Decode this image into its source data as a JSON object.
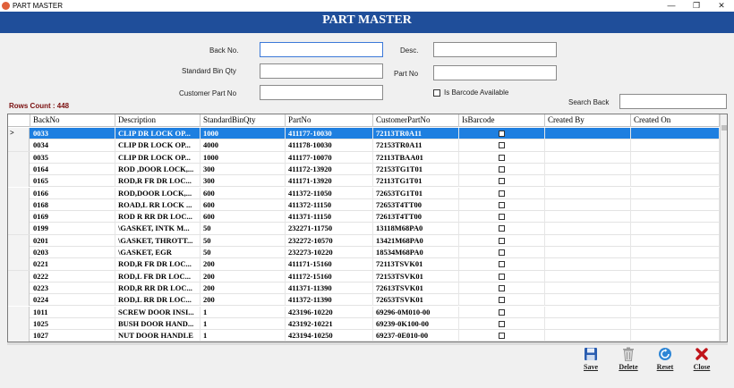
{
  "window": {
    "title": "PART MASTER",
    "minimize_glyph": "—",
    "restore_glyph": "❐",
    "close_glyph": "✕"
  },
  "header": {
    "title": "PART MASTER"
  },
  "form": {
    "back_no": {
      "label": "Back No.",
      "value": ""
    },
    "standard_bin_qty": {
      "label": "Standard Bin Qty",
      "value": ""
    },
    "customer_part_no": {
      "label": "Customer Part No",
      "value": ""
    },
    "desc": {
      "label": "Desc.",
      "value": ""
    },
    "part_no": {
      "label": "Part No",
      "value": ""
    },
    "is_barcode_available": {
      "label": "Is Barcode Available",
      "checked": false
    },
    "search_back": {
      "label": "Search Back",
      "value": ""
    }
  },
  "rows_count": "Rows Count : 448",
  "grid": {
    "columns": [
      "BackNo",
      "Description",
      "StandardBinQty",
      "PartNo",
      "CustomerPartNo",
      "IsBarcode",
      "Created By",
      "Created On"
    ],
    "selected_row_marker": ">",
    "rows": [
      {
        "back_no": "0033",
        "description": "CLIP DR LOCK OP...",
        "bin_qty": "1000",
        "part_no": "411177-10030",
        "customer_part_no": "72113TR0A11",
        "is_barcode": false,
        "created_by": "",
        "created_on": ""
      },
      {
        "back_no": "0034",
        "description": "CLIP DR LOCK OP...",
        "bin_qty": "4000",
        "part_no": "411178-10030",
        "customer_part_no": "72153TR0A11",
        "is_barcode": false,
        "created_by": "",
        "created_on": ""
      },
      {
        "back_no": "0035",
        "description": "CLIP DR LOCK OP...",
        "bin_qty": "1000",
        "part_no": "411177-10070",
        "customer_part_no": "72113TBAA01",
        "is_barcode": false,
        "created_by": "",
        "created_on": ""
      },
      {
        "back_no": "0164",
        "description": "ROD ,DOOR LOCK,...",
        "bin_qty": "300",
        "part_no": "411172-13920",
        "customer_part_no": "72153TG1T01",
        "is_barcode": false,
        "created_by": "",
        "created_on": ""
      },
      {
        "back_no": "0165",
        "description": "ROD,R FR DR LOC...",
        "bin_qty": "300",
        "part_no": "411171-13920",
        "customer_part_no": "72113TG1T01",
        "is_barcode": false,
        "created_by": "",
        "created_on": ""
      },
      {
        "back_no": "0166",
        "description": "ROD,DOOR LOCK,...",
        "bin_qty": "600",
        "part_no": "411372-11050",
        "customer_part_no": "72653TG1T01",
        "is_barcode": false,
        "created_by": "",
        "created_on": ""
      },
      {
        "back_no": "0168",
        "description": "ROAD,L RR LOCK ...",
        "bin_qty": "600",
        "part_no": "411372-11150",
        "customer_part_no": "72653T4TT00",
        "is_barcode": false,
        "created_by": "",
        "created_on": ""
      },
      {
        "back_no": "0169",
        "description": "ROD R RR DR LOC...",
        "bin_qty": "600",
        "part_no": "411371-11150",
        "customer_part_no": "72613T4TT00",
        "is_barcode": false,
        "created_by": "",
        "created_on": ""
      },
      {
        "back_no": "0199",
        "description": "\\GASKET, INTK M...",
        "bin_qty": "50",
        "part_no": "232271-11750",
        "customer_part_no": "13118M68PA0",
        "is_barcode": false,
        "created_by": "",
        "created_on": ""
      },
      {
        "back_no": "0201",
        "description": "\\GASKET, THROTT...",
        "bin_qty": "50",
        "part_no": "232272-10570",
        "customer_part_no": "13421M68PA0",
        "is_barcode": false,
        "created_by": "",
        "created_on": ""
      },
      {
        "back_no": "0203",
        "description": "\\GASKET, EGR",
        "bin_qty": "50",
        "part_no": "232273-10220",
        "customer_part_no": "18534M68PA0",
        "is_barcode": false,
        "created_by": "",
        "created_on": ""
      },
      {
        "back_no": "0221",
        "description": "ROD,R FR DR LOC...",
        "bin_qty": "200",
        "part_no": "411171-15160",
        "customer_part_no": "72113TSVK01",
        "is_barcode": false,
        "created_by": "",
        "created_on": ""
      },
      {
        "back_no": "0222",
        "description": "ROD,L FR DR LOC...",
        "bin_qty": "200",
        "part_no": "411172-15160",
        "customer_part_no": "72153TSVK01",
        "is_barcode": false,
        "created_by": "",
        "created_on": ""
      },
      {
        "back_no": "0223",
        "description": "ROD,R RR DR LOC...",
        "bin_qty": "200",
        "part_no": "411371-11390",
        "customer_part_no": "72613TSVK01",
        "is_barcode": false,
        "created_by": "",
        "created_on": ""
      },
      {
        "back_no": "0224",
        "description": "ROD,L RR DR LOC...",
        "bin_qty": "200",
        "part_no": "411372-11390",
        "customer_part_no": "72653TSVK01",
        "is_barcode": false,
        "created_by": "",
        "created_on": ""
      },
      {
        "back_no": "1011",
        "description": "SCREW DOOR INSI...",
        "bin_qty": "1",
        "part_no": "423196-10220",
        "customer_part_no": "69296-0M010-00",
        "is_barcode": false,
        "created_by": "",
        "created_on": ""
      },
      {
        "back_no": "1025",
        "description": "BUSH DOOR HAND...",
        "bin_qty": "1",
        "part_no": "423192-10221",
        "customer_part_no": "69239-0K100-00",
        "is_barcode": false,
        "created_by": "",
        "created_on": ""
      },
      {
        "back_no": "1027",
        "description": "NUT DOOR HANDLE",
        "bin_qty": "1",
        "part_no": "423194-10250",
        "customer_part_no": "69237-0E010-00",
        "is_barcode": false,
        "created_by": "",
        "created_on": ""
      }
    ]
  },
  "toolbar": {
    "save_label": "Save",
    "delete_label": "Delete",
    "reset_label": "Reset",
    "close_label": "Close"
  },
  "colors": {
    "header_bg": "#1f4e9a",
    "selected_row": "#1e7fe0",
    "rows_count_text": "#7a0f0f",
    "save_icon": "#2a5db0",
    "reset_icon": "#2e86d6",
    "close_icon": "#c0141a"
  }
}
